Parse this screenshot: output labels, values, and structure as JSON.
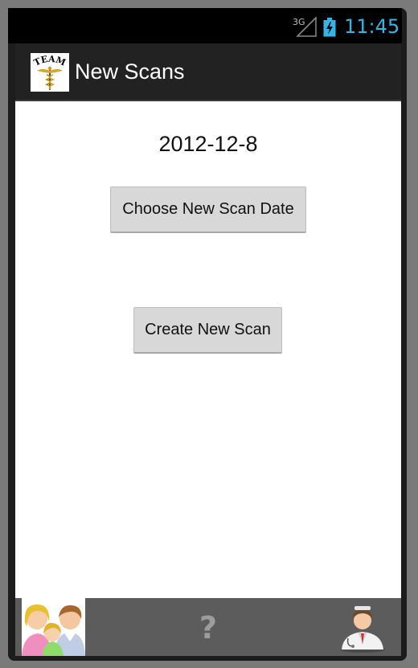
{
  "status_bar": {
    "network_label": "3G",
    "time": "11:45",
    "icons": [
      "signal-icon",
      "battery-charging-icon"
    ],
    "clock_color": "#33b5e5"
  },
  "action_bar": {
    "title": "New Scans",
    "logo_text": "TEAM",
    "logo_icon": "caduceus-icon"
  },
  "content": {
    "selected_date": "2012-12-8",
    "choose_date_button": "Choose New Scan Date",
    "create_scan_button": "Create New Scan"
  },
  "bottom_bar": {
    "icons": [
      "family-icon",
      "help-icon",
      "doctor-icon"
    ],
    "help_glyph": "?"
  }
}
